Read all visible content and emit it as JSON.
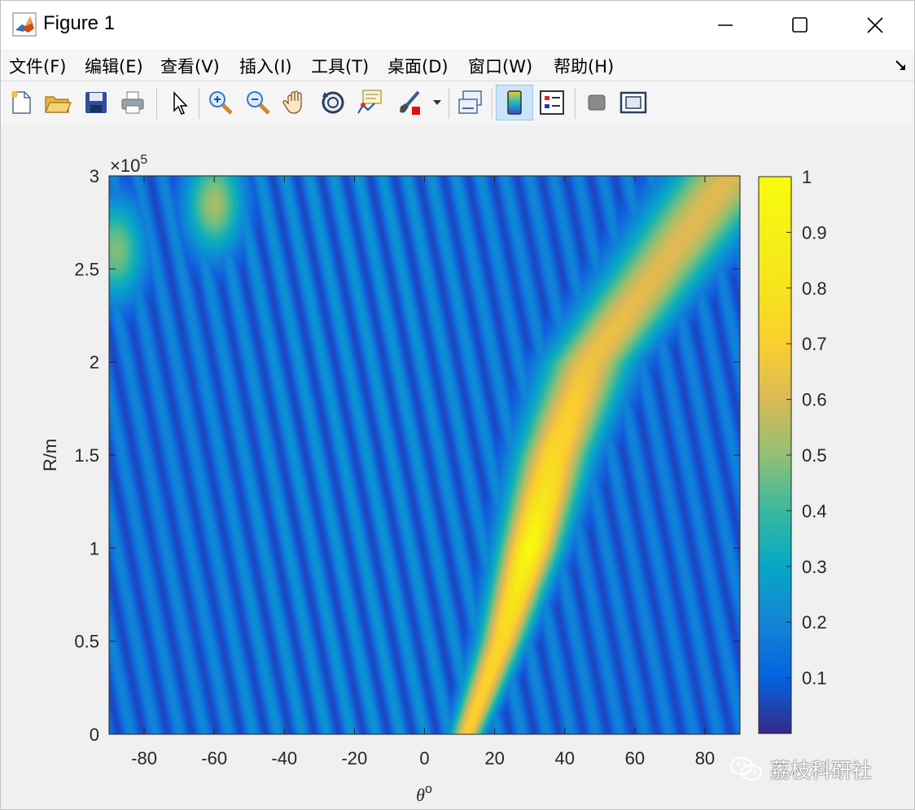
{
  "window": {
    "title": "Figure 1",
    "icon": "matlab-icon",
    "controls": [
      "minimize-icon",
      "maximize-icon",
      "close-icon"
    ]
  },
  "menubar": {
    "items": [
      {
        "label": "文件(F)",
        "mnemonic": "F"
      },
      {
        "label": "编辑(E)",
        "mnemonic": "E"
      },
      {
        "label": "查看(V)",
        "mnemonic": "V"
      },
      {
        "label": "插入(I)",
        "mnemonic": "I"
      },
      {
        "label": "工具(T)",
        "mnemonic": "T"
      },
      {
        "label": "桌面(D)",
        "mnemonic": "D"
      },
      {
        "label": "窗口(W)",
        "mnemonic": "W"
      },
      {
        "label": "帮助(H)",
        "mnemonic": "H"
      }
    ],
    "dock_icon": "dock-arrow-icon"
  },
  "toolbar": {
    "buttons": [
      "new-figure-icon",
      "open-file-icon",
      "save-icon",
      "print-icon",
      "edit-pointer-icon",
      "zoom-in-icon",
      "zoom-out-icon",
      "pan-icon",
      "rotate-3d-icon",
      "data-cursor-icon",
      "brush-icon",
      "link-plot-icon",
      "insert-colorbar-icon",
      "insert-legend-icon",
      "hide-plot-tools-icon",
      "show-plot-tools-icon"
    ],
    "active_button": "insert-colorbar-icon"
  },
  "chart_data": {
    "type": "heatmap",
    "colormap": "parula",
    "x": {
      "label": "θ",
      "label_superscript": "o",
      "lim": [
        -90,
        90
      ],
      "ticks": [
        -80,
        -60,
        -40,
        -20,
        0,
        20,
        40,
        60,
        80
      ]
    },
    "y": {
      "label": "R/m",
      "lim": [
        0,
        300000
      ],
      "ticks": [
        0,
        0.5,
        1,
        1.5,
        2,
        2.5,
        3
      ],
      "exponent_label": "×10",
      "exponent": "5"
    },
    "colorbar": {
      "lim": [
        0,
        1
      ],
      "ticks": [
        "0.1",
        "0.2",
        "0.3",
        "0.4",
        "0.5",
        "0.6",
        "0.7",
        "0.8",
        "0.9",
        "1"
      ]
    },
    "peak": {
      "theta": 30,
      "range": 100000,
      "value": 1.0
    },
    "main_ridge": [
      {
        "R": 0,
        "theta": 12,
        "value": 0.8
      },
      {
        "R": 50000,
        "theta": 22,
        "value": 0.85
      },
      {
        "R": 100000,
        "theta": 30,
        "value": 1.0
      },
      {
        "R": 150000,
        "theta": 37,
        "value": 0.85
      },
      {
        "R": 200000,
        "theta": 47,
        "value": 0.75
      },
      {
        "R": 250000,
        "theta": 67,
        "value": 0.7
      }
    ],
    "secondary_lobes": [
      {
        "theta": -60,
        "R": 285000,
        "value": 0.6
      },
      {
        "theta": -88,
        "R": 260000,
        "value": 0.55
      }
    ]
  },
  "colors": {
    "parula_low": "#352a87",
    "parula_mid": "#15b1c4",
    "parula_high": "#f9fb0e",
    "axis": "#262626"
  },
  "watermark": {
    "text": "荔枝科研社",
    "icon": "wechat-icon"
  }
}
